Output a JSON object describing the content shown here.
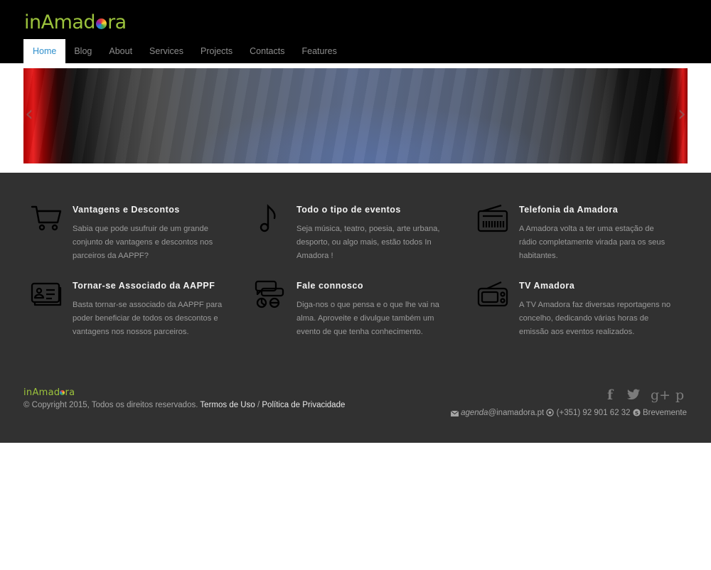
{
  "brand": {
    "logo_prefix": "inAmad",
    "logo_suffix": "ra",
    "footer_logo_prefix": "inAmad",
    "footer_logo_suffix": "ra"
  },
  "nav": {
    "items": [
      {
        "label": "Home",
        "active": true
      },
      {
        "label": "Blog"
      },
      {
        "label": "About"
      },
      {
        "label": "Services"
      },
      {
        "label": "Projects"
      },
      {
        "label": "Contacts"
      },
      {
        "label": "Features"
      }
    ]
  },
  "slider": {
    "prev_glyph": "‹",
    "next_glyph": "›"
  },
  "features": [
    {
      "icon": "shopping-cart-icon",
      "title": "Vantagens e Descontos",
      "text": "Sabia que pode usufruir de um grande conjunto de vantagens e descontos nos parceiros da AAPPF?"
    },
    {
      "icon": "music-note-icon",
      "title": "Todo o tipo de eventos",
      "text": "Seja música, teatro, poesia, arte urbana, desporto, ou algo mais, estão todos In Amadora !"
    },
    {
      "icon": "radio-icon",
      "title": "Telefonia da Amadora",
      "text": "A Amadora volta a ter uma estação de rádio completamente virada para os seus habitantes."
    },
    {
      "icon": "id-card-icon",
      "title": "Tornar-se Associado da AAPPF",
      "text": "Basta tornar-se associado da AAPPF para poder beneficiar de todos os descontos e vantagens nos nossos parceiros."
    },
    {
      "icon": "chat-bubbles-icon",
      "title": "Fale connosco",
      "text": "Diga-nos o que pensa e o que lhe vai na alma. Aproveite e divulgue também um evento de que tenha conhecimento."
    },
    {
      "icon": "tv-icon",
      "title": "TV Amadora",
      "text": "A TV Amadora faz diversas reportagens no concelho, dedicando várias horas de emissão aos eventos realizados."
    }
  ],
  "footer": {
    "copyright": "© Copyright 2015, Todos os direitos reservados.",
    "terms": "Termos de Uso",
    "separator": "/",
    "privacy": "Política de Privacidade",
    "email_user": "agenda",
    "email_domain": "@inamadora.pt",
    "phone": "(+351) 92 901 62 32",
    "skype": "Brevemente",
    "social": [
      {
        "name": "facebook-icon",
        "glyph": "f"
      },
      {
        "name": "twitter-icon",
        "glyph": "t"
      },
      {
        "name": "google-plus-icon",
        "glyph": "g+"
      },
      {
        "name": "pinterest-icon",
        "glyph": "p"
      }
    ]
  },
  "colors": {
    "brand_green": "#9bc23c",
    "nav_active": "#2f8fcc",
    "footer_bg": "#313131"
  }
}
